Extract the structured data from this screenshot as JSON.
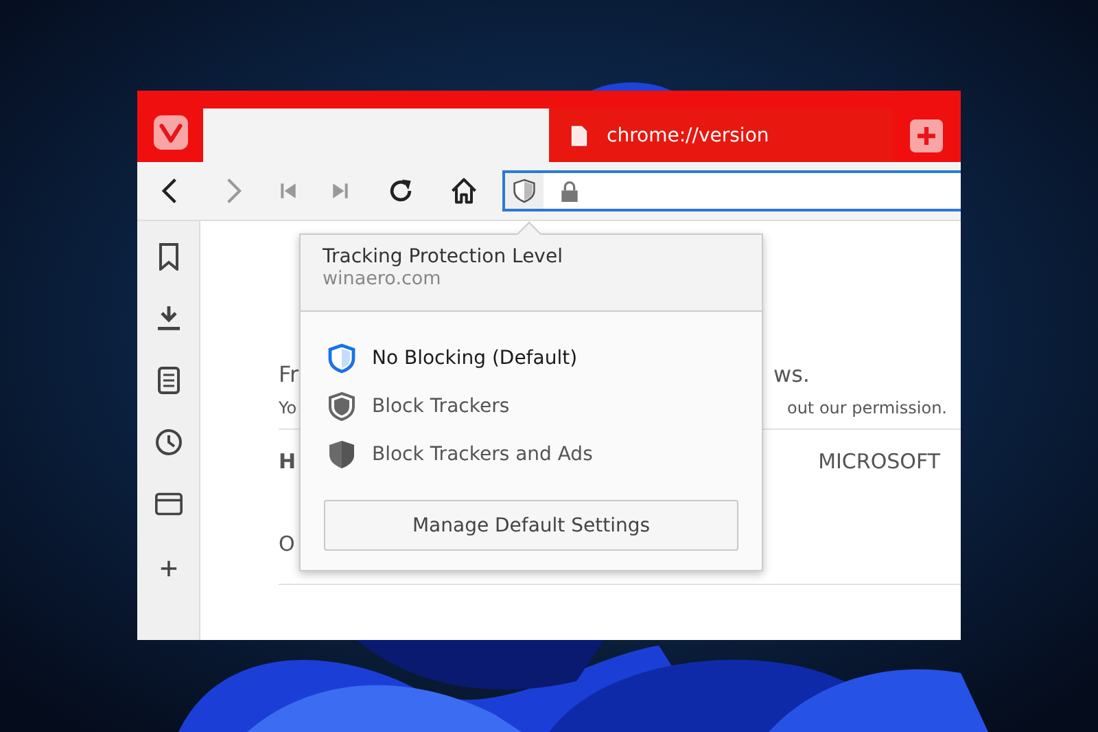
{
  "tabs": [
    {
      "selected": true
    },
    {
      "title": "chrome://version",
      "selected": false
    }
  ],
  "address_bar": {
    "focused": true
  },
  "page": {
    "lines": [
      {
        "kind": "lead",
        "left": "Fr",
        "right": "ws."
      },
      {
        "kind": "small",
        "left": "Yo",
        "right": "out our permission."
      },
      {
        "kind": "table",
        "left": "H",
        "right": "MICROSOFT"
      },
      {
        "kind": "plain",
        "left": "O"
      }
    ]
  },
  "popup": {
    "title": "Tracking Protection Level",
    "site": "winaero.com",
    "options": [
      {
        "kind": "none",
        "label": "No Blocking (Default)",
        "selected": true
      },
      {
        "kind": "trackers",
        "label": "Block Trackers",
        "selected": false
      },
      {
        "kind": "ads",
        "label": "Block Trackers and Ads",
        "selected": false
      }
    ],
    "button": "Manage Default Settings"
  }
}
